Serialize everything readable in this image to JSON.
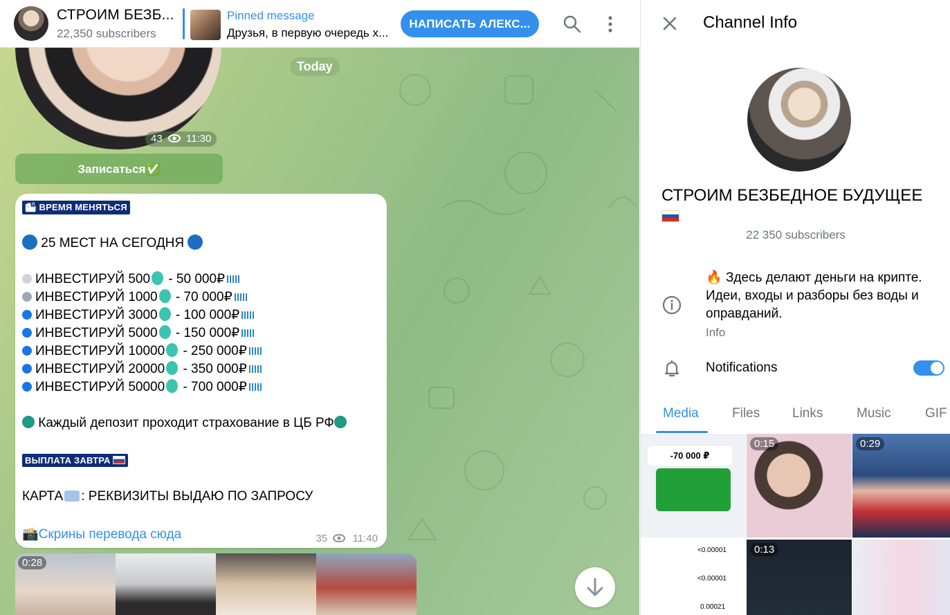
{
  "colors": {
    "accent": "#3390ec",
    "header_bg": "#ffffff",
    "chat_bg": "#a9c98a"
  },
  "chat_header": {
    "title": "СТРОИМ БЕЗБ...",
    "subscribers": "22,350 subscribers",
    "pinned_title": "Pinned message",
    "pinned_text": "Друзья, в первую очередь х...",
    "write_button": "НАПИСАТЬ АЛЕКС...",
    "icons": [
      "search-icon",
      "more-vertical-icon"
    ]
  },
  "date_separator": "Today",
  "round_video": {
    "views": "43",
    "time": "11:30"
  },
  "inline_button": "Записаться✅",
  "post": {
    "tag_top": "ВРЕМЯ МЕНЯТЬСЯ",
    "headline": "25 МЕСТ НА СЕГОДНЯ",
    "offers": [
      {
        "dot_color": "#d0d3d8",
        "label": "ИНВЕСТИРУЙ 500",
        "result": " -  50 000₽"
      },
      {
        "dot_color": "#a0a7b4",
        "label": "ИНВЕСТИРУЙ 1000",
        "result": " - 70 000₽"
      },
      {
        "dot_color": "#1877e8",
        "label": "ИНВЕСТИРУЙ 3000",
        "result": " - 100 000₽"
      },
      {
        "dot_color": "#1877e8",
        "label": "ИНВЕСТИРУЙ 5000",
        "result": " - 150 000₽"
      },
      {
        "dot_color": "#1877e8",
        "label": "ИНВЕСТИРУЙ 10000",
        "result": " - 250 000₽"
      },
      {
        "dot_color": "#1877e8",
        "label": "ИНВЕСТИРУЙ 20000",
        "result": " - 350 000₽"
      },
      {
        "dot_color": "#1877e8",
        "label": "ИНВЕСТИРУЙ 50000",
        "result": " - 700 000₽"
      }
    ],
    "insurance": "Каждый депозит проходит страхование в ЦБ РФ",
    "tag_payout": "ВЫПЛАТА ЗАВТРА",
    "card_prefix": "КАРТА",
    "card_text": "РЕКВИЗИТЫ ВЫДАЮ ПО ЗАПРОСУ",
    "link": "Скрины перевода сюда",
    "views": "35",
    "time": "11:40"
  },
  "album": {
    "duration": "0:28"
  },
  "info_panel": {
    "title": "Channel Info",
    "name": "СТРОИМ БЕЗБЕДНОЕ БУДУЩЕЕ",
    "subscribers": "22 350 subscribers",
    "about": "Здесь делают деньги на крипте. Идеи, входы и разборы без воды и оправданий.",
    "about_label": "Info",
    "notifications_label": "Notifications",
    "notifications_on": true,
    "tabs": [
      "Media",
      "Files",
      "Links",
      "Music",
      "GIF"
    ],
    "active_tab": "Media",
    "media": [
      {
        "duration": "",
        "title": "-70 000 ₽"
      },
      {
        "duration": "0:15"
      },
      {
        "duration": "0:29"
      },
      {
        "duration": "",
        "rows": [
          "<0.00001",
          "<0.00001",
          "0.00021"
        ]
      },
      {
        "duration": "0:13"
      },
      {
        "duration": ""
      }
    ]
  }
}
